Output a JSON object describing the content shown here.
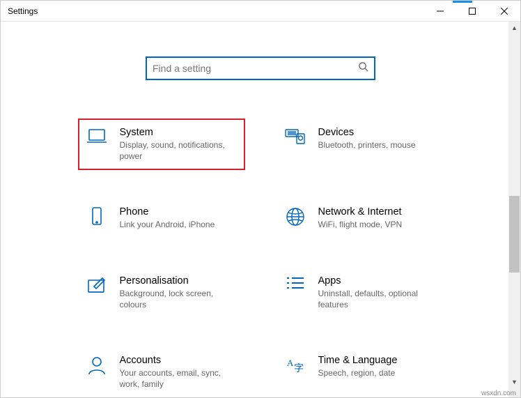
{
  "window": {
    "title": "Settings"
  },
  "search": {
    "placeholder": "Find a setting"
  },
  "tiles": [
    {
      "title": "System",
      "desc": "Display, sound, notifications, power",
      "highlight": true
    },
    {
      "title": "Devices",
      "desc": "Bluetooth, printers, mouse",
      "highlight": false
    },
    {
      "title": "Phone",
      "desc": "Link your Android, iPhone",
      "highlight": false
    },
    {
      "title": "Network & Internet",
      "desc": "WiFi, flight mode, VPN",
      "highlight": false
    },
    {
      "title": "Personalisation",
      "desc": "Background, lock screen, colours",
      "highlight": false
    },
    {
      "title": "Apps",
      "desc": "Uninstall, defaults, optional features",
      "highlight": false
    },
    {
      "title": "Accounts",
      "desc": "Your accounts, email, sync, work, family",
      "highlight": false
    },
    {
      "title": "Time & Language",
      "desc": "Speech, region, date",
      "highlight": false
    }
  ],
  "watermark": "wsxdn.com"
}
